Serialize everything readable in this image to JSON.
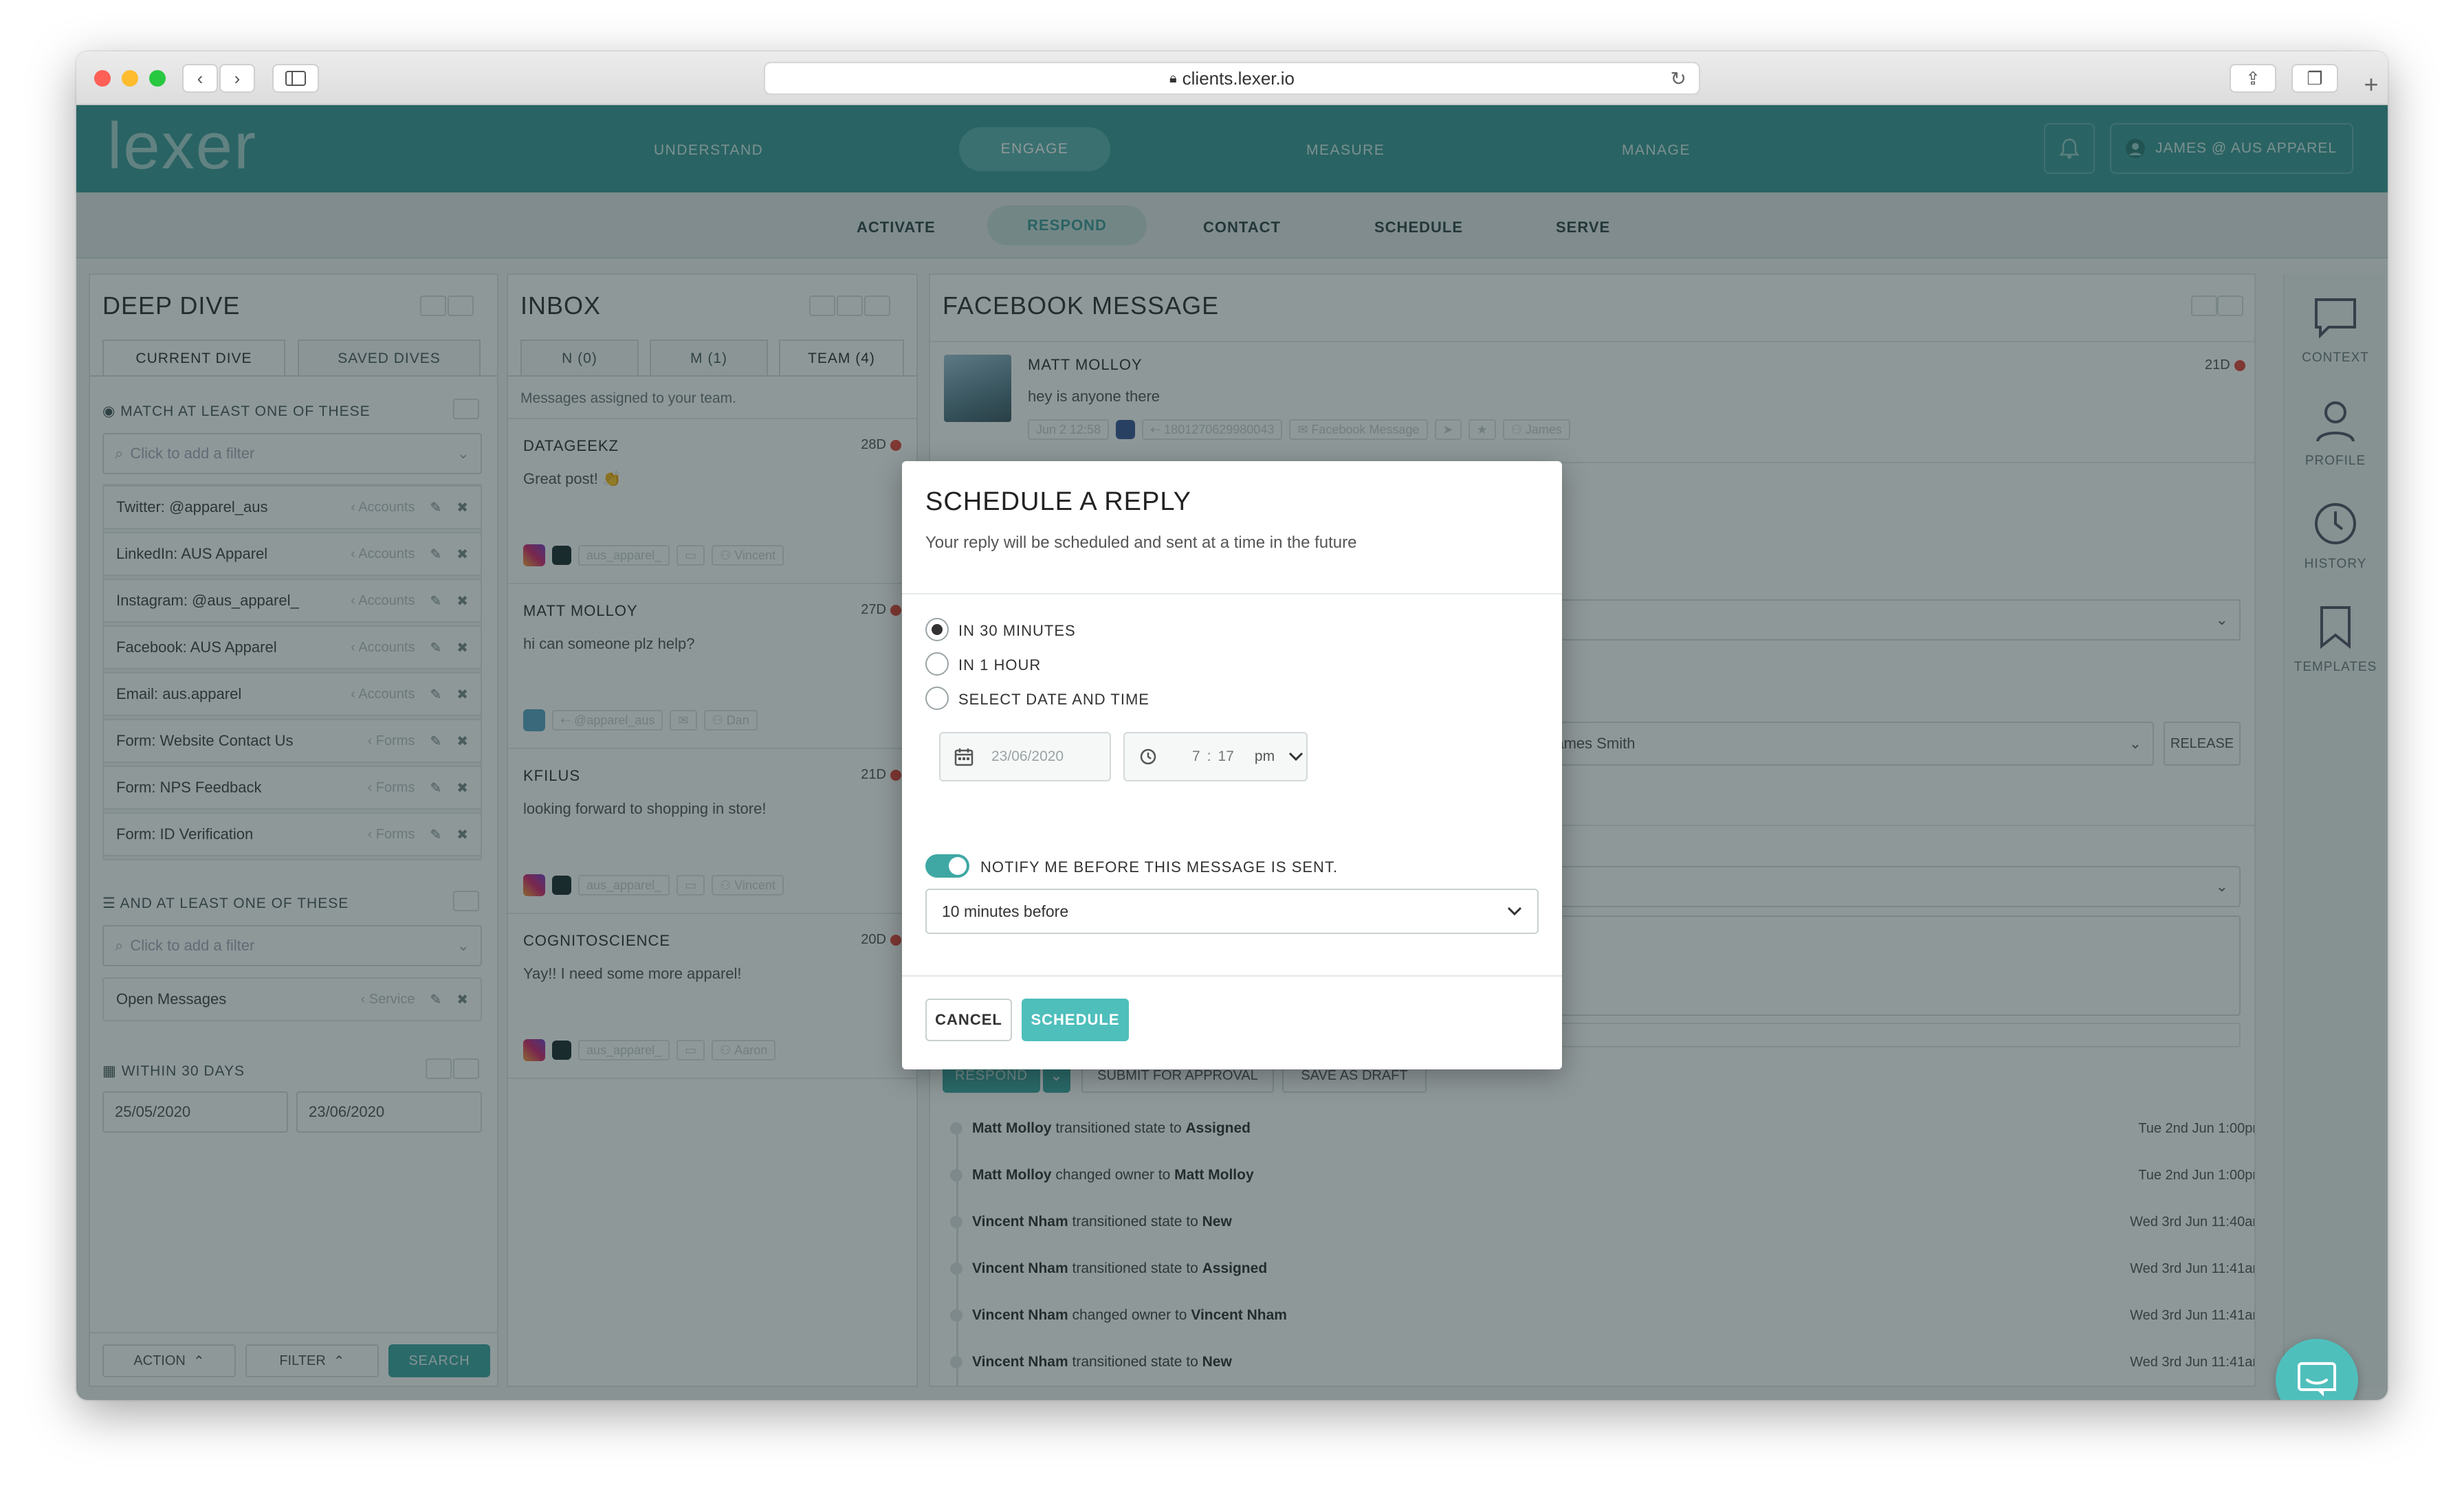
{
  "browser": {
    "url": "clients.lexer.io"
  },
  "top_nav": {
    "logo_text": "lexer",
    "items": [
      "UNDERSTAND",
      "ENGAGE",
      "MEASURE",
      "MANAGE"
    ],
    "active": "ENGAGE",
    "user": "JAMES @ AUS APPAREL"
  },
  "sub_nav": {
    "items": [
      "ACTIVATE",
      "RESPOND",
      "CONTACT",
      "SCHEDULE",
      "SERVE"
    ],
    "active": "RESPOND"
  },
  "deep_dive": {
    "title": "DEEP DIVE",
    "tabs": [
      "CURRENT DIVE",
      "SAVED DIVES"
    ],
    "match_heading": "MATCH AT LEAST ONE OF THESE",
    "add_filter_placeholder": "Click to add a filter",
    "filters": [
      {
        "label": "Twitter: @apparel_aus",
        "type": "Accounts"
      },
      {
        "label": "LinkedIn: AUS Apparel",
        "type": "Accounts"
      },
      {
        "label": "Instagram: @aus_apparel_",
        "type": "Accounts"
      },
      {
        "label": "Facebook: AUS Apparel",
        "type": "Accounts"
      },
      {
        "label": "Email: aus.apparel",
        "type": "Accounts"
      },
      {
        "label": "Form: Website Contact Us",
        "type": "Forms"
      },
      {
        "label": "Form: NPS Feedback",
        "type": "Forms"
      },
      {
        "label": "Form: ID Verification",
        "type": "Forms"
      }
    ],
    "and_heading": "AND AT LEAST ONE OF THESE",
    "and_filters": [
      {
        "label": "Open Messages",
        "type": "Service"
      }
    ],
    "within_heading": "WITHIN 30 DAYS",
    "date_from": "25/05/2020",
    "date_to": "23/06/2020",
    "footer": {
      "action": "ACTION",
      "filter": "FILTER",
      "search": "SEARCH"
    }
  },
  "inbox": {
    "title": "INBOX",
    "tabs": [
      "N (0)",
      "M (1)",
      "TEAM (4)"
    ],
    "note": "Messages assigned to your team.",
    "messages": [
      {
        "name": "DATAGEEKZ",
        "age": "28D",
        "text": "Great post! 👏",
        "account": "aus_apparel_",
        "assignee": "Vincent",
        "network": "instagram"
      },
      {
        "name": "MATT MOLLOY",
        "age": "27D",
        "text": "hi can someone plz help?",
        "account": "@apparel_aus",
        "assignee": "Dan",
        "network": "twitter"
      },
      {
        "name": "KFILUS",
        "age": "21D",
        "text": "looking forward to shopping in store!",
        "account": "aus_apparel_",
        "assignee": "Vincent",
        "network": "instagram"
      },
      {
        "name": "COGNITOSCIENCE",
        "age": "20D",
        "text": "Yay!! I need some more apparel!",
        "account": "aus_apparel_",
        "assignee": "Aaron",
        "network": "instagram"
      }
    ]
  },
  "fb_message": {
    "title": "FACEBOOK MESSAGE",
    "sender": "MATT MOLLOY",
    "age": "21D",
    "text": "hey is anyone there",
    "date_tag": "Jun 2 12:58",
    "id_tag": "1801270629980043",
    "channel_tag": "Facebook Message",
    "owner_tag": "James",
    "assignee_placeholder": "James Smith",
    "release_label": "RELEASE",
    "actions": {
      "respond": "RESPOND",
      "submit": "SUBMIT FOR APPROVAL",
      "draft": "SAVE AS DRAFT"
    },
    "history": [
      {
        "actor": "Matt Molloy",
        "verb": "transitioned state to",
        "target": "Assigned",
        "time": "Tue 2nd Jun 1:00pm"
      },
      {
        "actor": "Matt Molloy",
        "verb": "changed owner to",
        "target": "Matt Molloy",
        "time": "Tue 2nd Jun 1:00pm"
      },
      {
        "actor": "Vincent Nham",
        "verb": "transitioned state to",
        "target": "New",
        "time": "Wed 3rd Jun 11:40am"
      },
      {
        "actor": "Vincent Nham",
        "verb": "transitioned state to",
        "target": "Assigned",
        "time": "Wed 3rd Jun 11:41am"
      },
      {
        "actor": "Vincent Nham",
        "verb": "changed owner to",
        "target": "Vincent Nham",
        "time": "Wed 3rd Jun 11:41am"
      },
      {
        "actor": "Vincent Nham",
        "verb": "transitioned state to",
        "target": "New",
        "time": "Wed 3rd Jun 11:41am"
      }
    ]
  },
  "right_rail": {
    "items": [
      "CONTEXT",
      "PROFILE",
      "HISTORY",
      "TEMPLATES"
    ]
  },
  "modal": {
    "title": "SCHEDULE A REPLY",
    "subtitle": "Your reply will be scheduled and sent at a time in the future",
    "options": [
      "IN 30 MINUTES",
      "IN 1 HOUR",
      "SELECT DATE AND TIME"
    ],
    "selected_option": "IN 30 MINUTES",
    "date": "23/06/2020",
    "time_hour": "7",
    "time_minute": "17",
    "time_ampm": "pm",
    "notify_label": "NOTIFY ME BEFORE THIS MESSAGE IS SENT.",
    "notify_on": true,
    "notify_select": "10 minutes before",
    "cancel_label": "CANCEL",
    "schedule_label": "SCHEDULE"
  },
  "colors": {
    "brand": "#3e9a98",
    "accent": "#4fbfbc",
    "alert": "#e0473d"
  }
}
